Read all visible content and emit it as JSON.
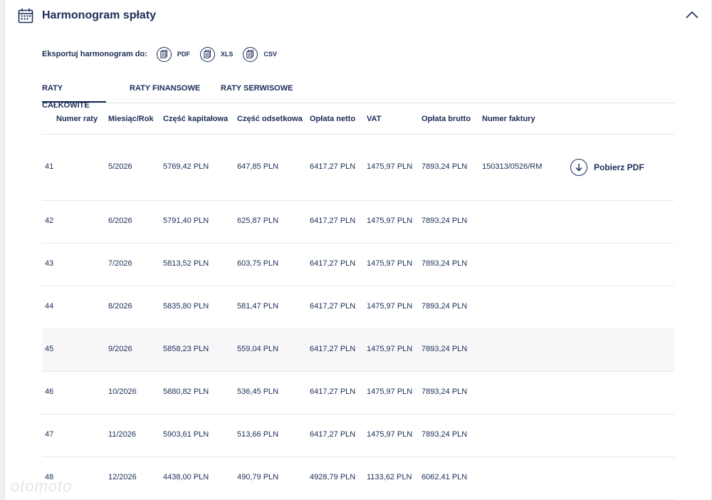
{
  "header": {
    "title": "Harmonogram spłaty",
    "calendar_icon": "calendar-icon",
    "collapse_icon": "chevron-up-icon"
  },
  "export": {
    "label": "Eksportuj harmonogram do:",
    "options": [
      {
        "label": "PDF",
        "icon": "document-icon"
      },
      {
        "label": "XLS",
        "icon": "document-icon"
      },
      {
        "label": "CSV",
        "icon": "document-icon"
      }
    ]
  },
  "tabs": [
    {
      "label": "RATY CAŁKOWITE",
      "active": true
    },
    {
      "label": "RATY FINANSOWE",
      "active": false
    },
    {
      "label": "RATY SERWISOWE",
      "active": false
    }
  ],
  "table": {
    "columns": [
      "Numer raty",
      "Miesiąc/Rok",
      "Część kapitałowa",
      "Część odsetkowa",
      "Opłata netto",
      "VAT",
      "Opłata brutto",
      "Numer faktury"
    ],
    "rows": [
      {
        "num": "41",
        "month": "5/2026",
        "capital": "5769,42 PLN",
        "interest": "647,85 PLN",
        "net": "6417,27 PLN",
        "vat": "1475,97 PLN",
        "gross": "7893,24 PLN",
        "invoice": "150313/0526/RM",
        "download": "Pobierz PDF"
      },
      {
        "num": "42",
        "month": "6/2026",
        "capital": "5791,40 PLN",
        "interest": "625,87 PLN",
        "net": "6417,27 PLN",
        "vat": "1475,97 PLN",
        "gross": "7893,24 PLN",
        "invoice": "",
        "download": ""
      },
      {
        "num": "43",
        "month": "7/2026",
        "capital": "5813,52 PLN",
        "interest": "603,75 PLN",
        "net": "6417,27 PLN",
        "vat": "1475,97 PLN",
        "gross": "7893,24 PLN",
        "invoice": "",
        "download": ""
      },
      {
        "num": "44",
        "month": "8/2026",
        "capital": "5835,80 PLN",
        "interest": "581,47 PLN",
        "net": "6417,27 PLN",
        "vat": "1475,97 PLN",
        "gross": "7893,24 PLN",
        "invoice": "",
        "download": ""
      },
      {
        "num": "45",
        "month": "9/2026",
        "capital": "5858,23 PLN",
        "interest": "559,04 PLN",
        "net": "6417,27 PLN",
        "vat": "1475,97 PLN",
        "gross": "7893,24 PLN",
        "invoice": "",
        "download": ""
      },
      {
        "num": "46",
        "month": "10/2026",
        "capital": "5880,82 PLN",
        "interest": "536,45 PLN",
        "net": "6417,27 PLN",
        "vat": "1475,97 PLN",
        "gross": "7893,24 PLN",
        "invoice": "",
        "download": ""
      },
      {
        "num": "47",
        "month": "11/2026",
        "capital": "5903,61 PLN",
        "interest": "513,66 PLN",
        "net": "6417,27 PLN",
        "vat": "1475,97 PLN",
        "gross": "7893,24 PLN",
        "invoice": "",
        "download": ""
      },
      {
        "num": "48",
        "month": "12/2026",
        "capital": "4438,00 PLN",
        "interest": "490,79 PLN",
        "net": "4928,79 PLN",
        "vat": "1133,62 PLN",
        "gross": "6062,41 PLN",
        "invoice": "",
        "download": ""
      }
    ]
  },
  "colors": {
    "primary": "#1a2d57",
    "border": "#e4e7ec",
    "shaded_row": "#f7f7f9"
  }
}
